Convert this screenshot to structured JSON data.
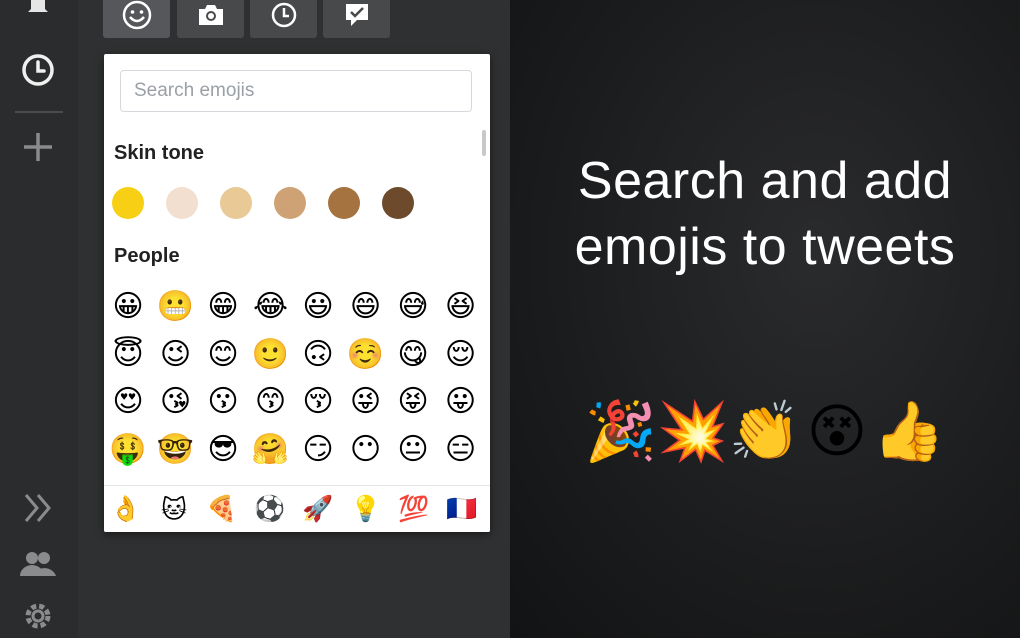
{
  "search": {
    "placeholder": "Search emojis"
  },
  "sections": {
    "skin_tone": "Skin tone",
    "people": "People"
  },
  "skin_tones": [
    "#f7cf14",
    "#f3dfcf",
    "#e9c996",
    "#cfa275",
    "#a5733f",
    "#6e4a2c"
  ],
  "people_emojis": [
    [
      "😀",
      "😬",
      "😁",
      "😂",
      "😃",
      "😄",
      "😅",
      "😆"
    ],
    [
      "😇",
      "😉",
      "😊",
      "🙂",
      "🙃",
      "☺️",
      "😋",
      "😌"
    ],
    [
      "😍",
      "😘",
      "😗",
      "😙",
      "😚",
      "😜",
      "😝",
      "😛"
    ],
    [
      "🤑",
      "🤓",
      "😎",
      "🤗",
      "😏",
      "😶",
      "😐",
      "😑"
    ]
  ],
  "categories": [
    "👌",
    "🐱",
    "🍕",
    "⚽",
    "🚀",
    "💡",
    "💯",
    "🇫🇷"
  ],
  "promo": {
    "headline_line1": "Search and add",
    "headline_line2": "emojis to tweets",
    "emojis": [
      "🎉",
      "💥",
      "👏",
      "😵",
      "👍"
    ]
  },
  "colors": {
    "sidebar_bg": "#2b2c2d",
    "column_bg": "#2f3031",
    "popup_bg": "#ffffff",
    "promo_text": "#ffffff"
  },
  "icons": {
    "sidebar": [
      "bell-icon",
      "clock-icon",
      "plus-icon",
      "expand-icon",
      "team-icon",
      "gear-icon"
    ],
    "tabs": [
      "emoji-icon",
      "camera-icon",
      "clock-icon",
      "message-icon"
    ]
  }
}
